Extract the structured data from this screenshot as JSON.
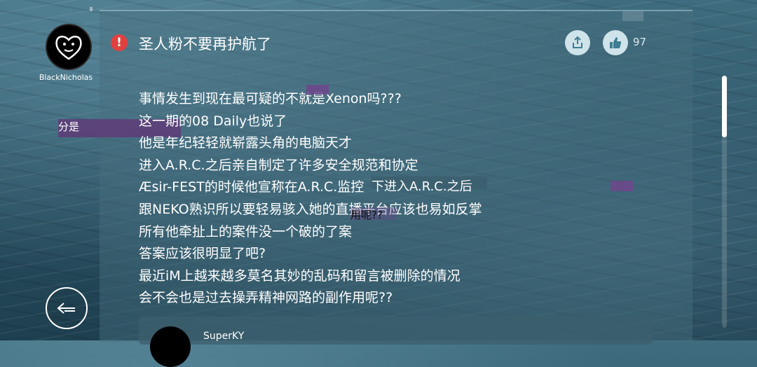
{
  "post": {
    "author": "BlackNicholas",
    "title": "圣人粉不要再护航了",
    "like_count": "97",
    "lines": [
      "事情发生到现在最可疑的不就是Xenon吗???",
      "这一期的08 Daily也说了",
      "他是年纪轻轻就崭露头角的电脑天才",
      "进入A.R.C.之后亲自制定了许多安全规范和协定",
      "Æsir-FEST的时候他宣称在A.R.C.监控",
      "跟NEKO熟识所以要轻易骇入她的直播平台应该也易如反掌",
      "所有他牵扯上的案件没一个破的了案",
      "答案应该很明显了吧?",
      "最近iM上越来越多莫名其妙的乱码和留言被删除的情况",
      "会不会也是过去操弄精神网路的副作用呢??"
    ]
  },
  "glitch": {
    "fragment_left": "分是",
    "fragment_right": "用呢??",
    "fragment_overlay": "下进入A.R.C.之后"
  },
  "reply": {
    "author": "SuperKY"
  },
  "icons": {
    "warning": "exclamation-icon",
    "share": "share-icon",
    "like": "thumbs-up-icon",
    "back": "back-arrow-icon"
  },
  "colors": {
    "warning": "#e0413f",
    "button_bg": "#cfe3ea",
    "button_fg": "#3f7d93"
  }
}
